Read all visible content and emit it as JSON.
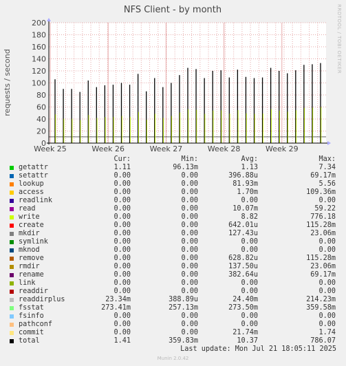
{
  "chart_data": {
    "type": "bar",
    "title": "NFS Client - by month",
    "ylabel": "requests / second",
    "xlabel": "",
    "side_label": "RRDTOOL / TOBI OETIKER",
    "ylim": [
      0,
      200
    ],
    "yticks": [
      0,
      20,
      40,
      60,
      80,
      100,
      120,
      140,
      160,
      180,
      200
    ],
    "x_ticks": [
      "Week 25",
      "Week 26",
      "Week 27",
      "Week 28",
      "Week 29"
    ],
    "grid": true,
    "spike_series": "total",
    "spike_values": [
      106,
      90,
      90,
      85,
      104,
      93,
      96,
      97,
      100,
      97,
      115,
      86,
      108,
      93,
      100,
      113,
      125,
      123,
      108,
      120,
      121,
      109,
      122,
      110,
      108,
      109,
      125,
      120,
      116,
      121,
      130,
      131,
      133
    ],
    "baseline_value": 10.37
  },
  "legend": {
    "headers": [
      "Cur:",
      "Min:",
      "Avg:",
      "Max:"
    ],
    "rows": [
      {
        "name": "getattr",
        "color": "#00cc00",
        "cur": "1.11",
        "min": "96.13m",
        "avg": "1.13",
        "max": "7.34"
      },
      {
        "name": "setattr",
        "color": "#0066b3",
        "cur": "0.00",
        "min": "0.00",
        "avg": "396.88u",
        "max": "69.17m"
      },
      {
        "name": "lookup",
        "color": "#ff8000",
        "cur": "0.00",
        "min": "0.00",
        "avg": "81.93m",
        "max": "5.56"
      },
      {
        "name": "access",
        "color": "#ffcc00",
        "cur": "0.00",
        "min": "0.00",
        "avg": "1.70m",
        "max": "109.36m"
      },
      {
        "name": "readlink",
        "color": "#330099",
        "cur": "0.00",
        "min": "0.00",
        "avg": "0.00",
        "max": "0.00"
      },
      {
        "name": "read",
        "color": "#990099",
        "cur": "0.00",
        "min": "0.00",
        "avg": "10.07m",
        "max": "59.22"
      },
      {
        "name": "write",
        "color": "#ccff00",
        "cur": "0.00",
        "min": "0.00",
        "avg": "8.82",
        "max": "776.18"
      },
      {
        "name": "create",
        "color": "#ff0000",
        "cur": "0.00",
        "min": "0.00",
        "avg": "642.01u",
        "max": "115.28m"
      },
      {
        "name": "mkdir",
        "color": "#808080",
        "cur": "0.00",
        "min": "0.00",
        "avg": "127.43u",
        "max": "23.06m"
      },
      {
        "name": "symlink",
        "color": "#008f00",
        "cur": "0.00",
        "min": "0.00",
        "avg": "0.00",
        "max": "0.00"
      },
      {
        "name": "mknod",
        "color": "#00487d",
        "cur": "0.00",
        "min": "0.00",
        "avg": "0.00",
        "max": "0.00"
      },
      {
        "name": "remove",
        "color": "#b35a00",
        "cur": "0.00",
        "min": "0.00",
        "avg": "628.82u",
        "max": "115.28m"
      },
      {
        "name": "rmdir",
        "color": "#b38f00",
        "cur": "0.00",
        "min": "0.00",
        "avg": "137.50u",
        "max": "23.06m"
      },
      {
        "name": "rename",
        "color": "#6b006b",
        "cur": "0.00",
        "min": "0.00",
        "avg": "382.64u",
        "max": "69.17m"
      },
      {
        "name": "link",
        "color": "#8fb300",
        "cur": "0.00",
        "min": "0.00",
        "avg": "0.00",
        "max": "0.00"
      },
      {
        "name": "readdir",
        "color": "#b30000",
        "cur": "0.00",
        "min": "0.00",
        "avg": "0.00",
        "max": "0.00"
      },
      {
        "name": "readdirplus",
        "color": "#bebebe",
        "cur": "23.34m",
        "min": "388.89u",
        "avg": "24.40m",
        "max": "214.23m"
      },
      {
        "name": "fsstat",
        "color": "#80ff80",
        "cur": "273.41m",
        "min": "257.13m",
        "avg": "273.50m",
        "max": "359.58m"
      },
      {
        "name": "fsinfo",
        "color": "#80c9ff",
        "cur": "0.00",
        "min": "0.00",
        "avg": "0.00",
        "max": "0.00"
      },
      {
        "name": "pathconf",
        "color": "#ffc080",
        "cur": "0.00",
        "min": "0.00",
        "avg": "0.00",
        "max": "0.00"
      },
      {
        "name": "commit",
        "color": "#ffe680",
        "cur": "0.00",
        "min": "0.00",
        "avg": "21.74m",
        "max": "1.74"
      },
      {
        "name": "total",
        "color": "#000000",
        "cur": "1.41",
        "min": "359.83m",
        "avg": "10.37",
        "max": "786.07"
      }
    ]
  },
  "footer": {
    "last_update": "Last update: Mon Jul 21 18:05:11 2025",
    "munin_version": "Munin 2.0.42"
  }
}
